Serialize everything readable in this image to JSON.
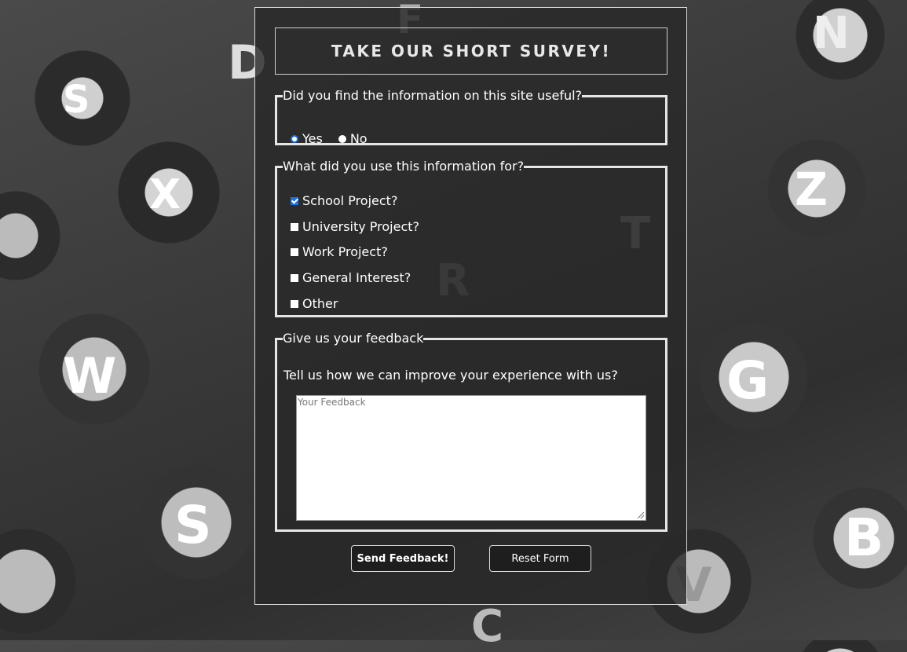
{
  "survey": {
    "title": "TAKE OUR SHORT SURVEY!",
    "q1": {
      "legend": "Did you find the information on this site useful?",
      "options": [
        {
          "label": "Yes",
          "checked": true
        },
        {
          "label": "No",
          "checked": false
        }
      ]
    },
    "q2": {
      "legend": "What did you use this information for?",
      "options": [
        {
          "label": "School Project?",
          "checked": true
        },
        {
          "label": "University Project?",
          "checked": false
        },
        {
          "label": "Work Project?",
          "checked": false
        },
        {
          "label": "General Interest?",
          "checked": false
        },
        {
          "label": "Other",
          "checked": false
        }
      ]
    },
    "q3": {
      "legend": "Give us your feedback",
      "prompt": "Tell us how we can improve your experience with us?",
      "placeholder": "Your Feedback"
    },
    "buttons": {
      "send_label": "Send Feedback!",
      "reset_label": "Reset Form"
    }
  },
  "background_keys": [
    "S",
    "D",
    "F",
    "X",
    "W",
    "S",
    "G",
    "Z",
    "B",
    "N",
    "T",
    "R",
    "C",
    "V"
  ],
  "colors": {
    "accent": "#1a73e8",
    "panel_border": "#d8d8d8",
    "fieldset_border": "#e6e6e6",
    "button_bg": "#1e1e1e"
  }
}
